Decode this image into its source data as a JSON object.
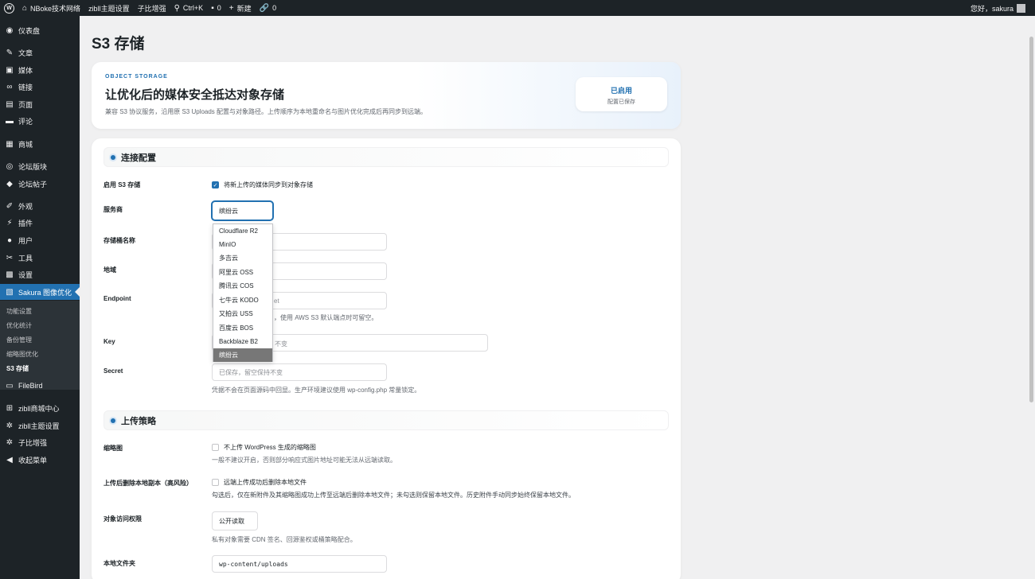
{
  "adminbar": {
    "site_name": "NBoke技术网络",
    "theme_settings": "zibll主题设置",
    "zibi": "子比增强",
    "search_shortcut": "Ctrl+K",
    "comments_count": "0",
    "new_label": "新建",
    "links_count": "0",
    "greeting": "您好，sakura"
  },
  "sidebar": {
    "items": [
      {
        "label": "仪表盘",
        "icon": "dashboard-icon"
      },
      {
        "label": "文章",
        "icon": "pin-icon"
      },
      {
        "label": "媒体",
        "icon": "media-icon"
      },
      {
        "label": "链接",
        "icon": "link-icon"
      },
      {
        "label": "页面",
        "icon": "page-icon"
      },
      {
        "label": "评论",
        "icon": "comment-icon"
      },
      {
        "label": "商城",
        "icon": "store-icon"
      },
      {
        "label": "论坛版块",
        "icon": "forum-icon"
      },
      {
        "label": "论坛帖子",
        "icon": "forum-post-icon"
      },
      {
        "label": "外观",
        "icon": "brush-icon"
      },
      {
        "label": "插件",
        "icon": "plugin-icon"
      },
      {
        "label": "用户",
        "icon": "user-icon"
      },
      {
        "label": "工具",
        "icon": "wrench-icon"
      },
      {
        "label": "设置",
        "icon": "settings-icon"
      },
      {
        "label": "Sakura 图像优化",
        "icon": "image-icon"
      },
      {
        "label": "FileBird",
        "icon": "folder-icon"
      },
      {
        "label": "zibll商城中心",
        "icon": "cart-icon"
      },
      {
        "label": "zibll主题设置",
        "icon": "gear-icon"
      },
      {
        "label": "子比增强",
        "icon": "gear-icon"
      },
      {
        "label": "收起菜单",
        "icon": "collapse-icon"
      }
    ],
    "submenu": [
      "功能设置",
      "优化统计",
      "备份管理",
      "缩略图优化",
      "S3 存储"
    ]
  },
  "page": {
    "title": "S3 存储"
  },
  "hero": {
    "eyebrow": "OBJECT STORAGE",
    "title": "让优化后的媒体安全抵达对象存储",
    "desc": "兼容 S3 协议服务，沿用原 S3 Uploads 配置与对象路径。上传顺序为本地重命名与图片优化完成后再同步到远端。",
    "status_main": "已启用",
    "status_sub": "配置已保存"
  },
  "connection": {
    "heading": "连接配置",
    "enable_label": "启用 S3 存储",
    "enable_checkbox": "将新上传的媒体同步到对象存储",
    "provider_label": "服务商",
    "provider_value": "缤纷云",
    "provider_options": [
      "Cloudflare R2",
      "MinIO",
      "多吉云",
      "阿里云 OSS",
      "腾讯云 COS",
      "七牛云 KODO",
      "又拍云 USS",
      "百度云 BOS",
      "Backblaze B2",
      "缤纷云"
    ],
    "bucket_label": "存储桶名称",
    "region_label": "地域",
    "endpoint_label": "Endpoint",
    "endpoint_partial": "et",
    "endpoint_help_partial": "，使用 AWS S3 默认端点时可留空。",
    "key_label": "Key",
    "key_placeholder_partial": "不变",
    "secret_label": "Secret",
    "secret_placeholder": "已保存，留空保持不变",
    "secret_help": "凭据不会在页面源码中回显。生产环境建议使用 wp-config.php 常量锁定。"
  },
  "upload": {
    "heading": "上传策略",
    "thumb_label": "缩略图",
    "thumb_checkbox": "不上传 WordPress 生成的缩略图",
    "thumb_help": "一般不建议开启，否则部分响应式图片地址可能无法从远端读取。",
    "delete_label": "上传后删除本地副本（高风险）",
    "delete_checkbox": "远端上传成功后删除本地文件",
    "delete_help": "勾选后，仅在新附件及其缩略图成功上传至远端后删除本地文件；未勾选则保留本地文件。历史附件手动同步始终保留本地文件。",
    "acl_label": "对象访问权限",
    "acl_value": "公开读取",
    "acl_help": "私有对象需要 CDN 签名、回源鉴权或桶策略配合。",
    "folder_label": "本地文件夹",
    "folder_value": "wp-content/uploads"
  }
}
